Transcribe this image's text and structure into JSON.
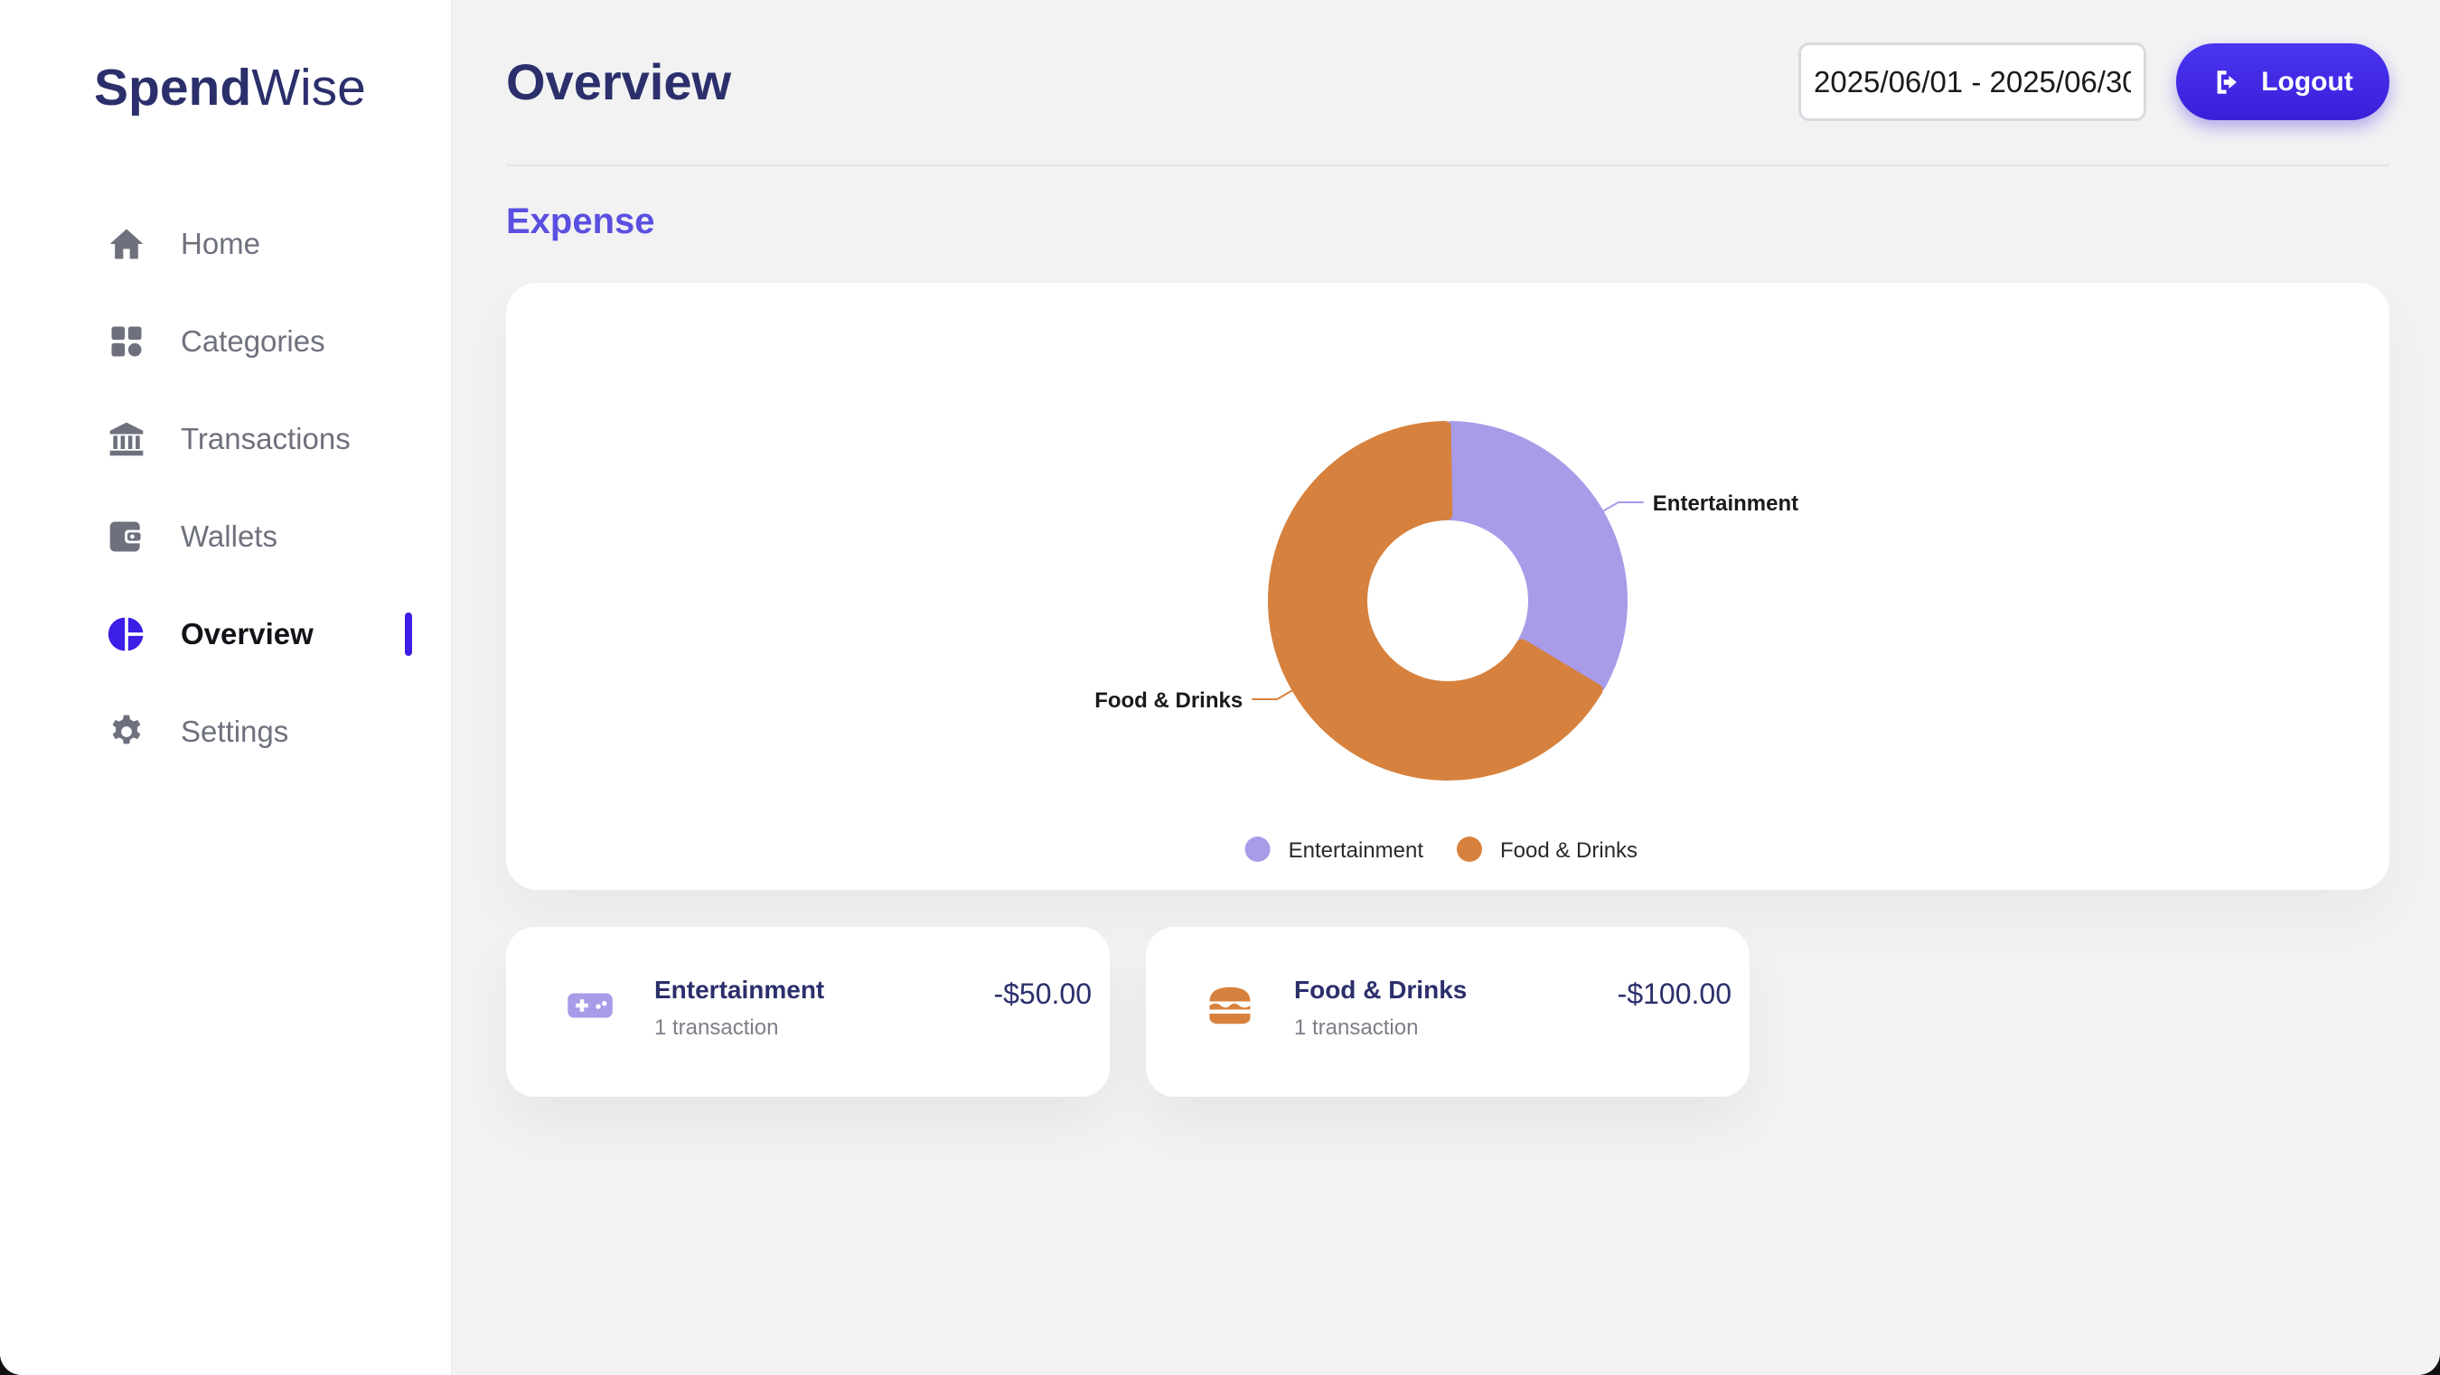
{
  "brand": {
    "part1": "Spend",
    "part2": "Wise"
  },
  "sidebar": {
    "items": [
      {
        "label": "Home",
        "icon": "home-icon",
        "active": false
      },
      {
        "label": "Categories",
        "icon": "categories-icon",
        "active": false
      },
      {
        "label": "Transactions",
        "icon": "bank-icon",
        "active": false
      },
      {
        "label": "Wallets",
        "icon": "wallet-icon",
        "active": false
      },
      {
        "label": "Overview",
        "icon": "pie-chart-icon",
        "active": true
      },
      {
        "label": "Settings",
        "icon": "gear-icon",
        "active": false
      }
    ]
  },
  "header": {
    "title": "Overview",
    "date_range": "2025/06/01 - 2025/06/30",
    "logout_label": "Logout"
  },
  "section": {
    "title": "Expense"
  },
  "colors": {
    "entertainment": "#a89be8",
    "food_drinks": "#d6813d",
    "accent": "#3b1fe6",
    "brand_text": "#2b2f6b"
  },
  "chart_data": {
    "type": "pie",
    "donut": true,
    "categories": [
      "Entertainment",
      "Food & Drinks"
    ],
    "values": [
      50,
      100
    ],
    "colors": [
      "#a89be8",
      "#d6813d"
    ],
    "legend": "bottom"
  },
  "cards": [
    {
      "name": "Entertainment",
      "count": "1 transaction",
      "amount": "-$50.00",
      "icon": "gamepad-icon"
    },
    {
      "name": "Food & Drinks",
      "count": "1 transaction",
      "amount": "-$100.00",
      "icon": "burger-icon"
    }
  ]
}
